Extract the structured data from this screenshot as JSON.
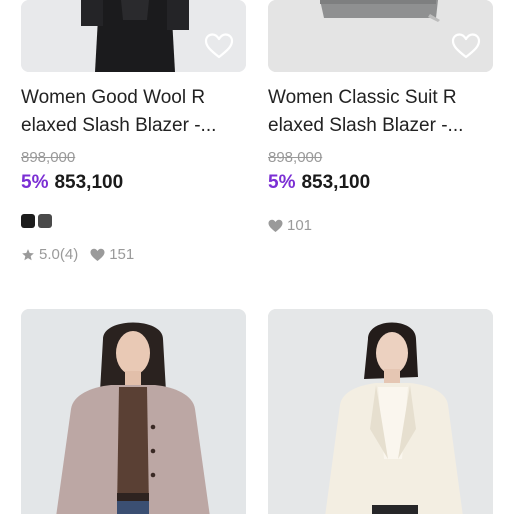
{
  "products": [
    {
      "name_line1": "Women Good Wool R",
      "name_line2": "elaxed Slash Blazer -...",
      "original_price": "898,000",
      "discount": "5%",
      "price": "853,100",
      "swatches": [
        "#1c1c1c",
        "#4a4a4a"
      ],
      "rating": "5.0(4)",
      "likes": "151",
      "image_icon": "black-suit-model-photo",
      "wishlist_icon": "heart-outline-icon"
    },
    {
      "name_line1": "Women Classic Suit R",
      "name_line2": "elaxed Slash Blazer -...",
      "original_price": "898,000",
      "discount": "5%",
      "price": "853,100",
      "likes": "101",
      "image_icon": "grey-blazer-photo",
      "wishlist_icon": "heart-outline-icon"
    },
    {
      "image_icon": "pink-jacket-model-photo"
    },
    {
      "image_icon": "ivory-blazer-model-photo"
    }
  ],
  "colors": {
    "discount": "#7b2fd4",
    "muted": "#9a9a9a"
  }
}
